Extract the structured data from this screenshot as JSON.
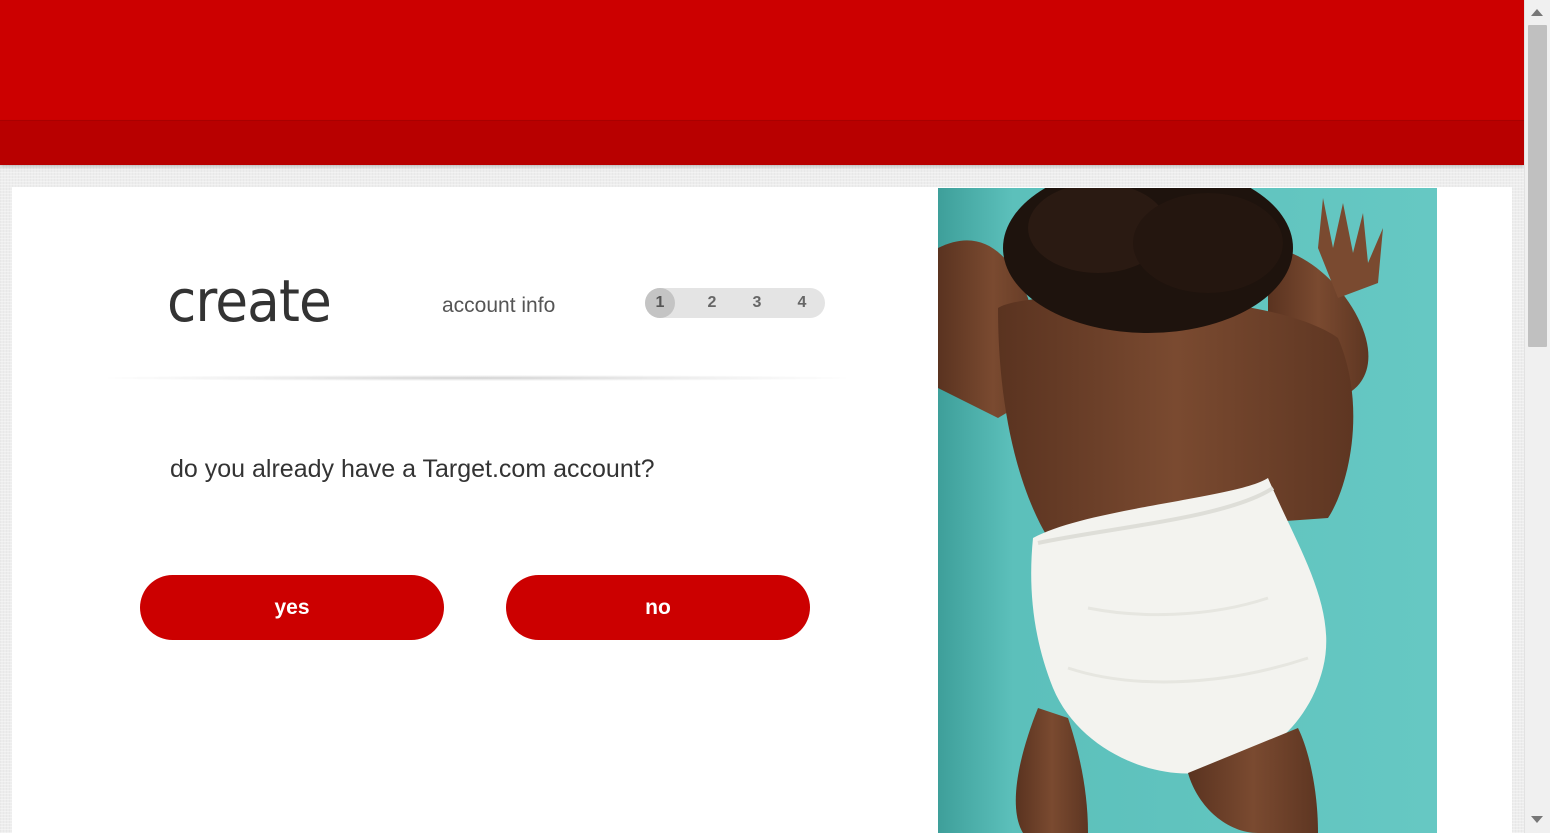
{
  "page": {
    "title": "create",
    "step_label": "account info",
    "steps": [
      "1",
      "2",
      "3",
      "4"
    ],
    "active_step": 1
  },
  "question": {
    "text": "do you already have a Target.com account?"
  },
  "buttons": {
    "yes_label": "yes",
    "no_label": "no"
  },
  "colors": {
    "brand_red": "#cc0000",
    "header_dark_red": "#b80000",
    "photo_background": "#5cc0bb"
  },
  "icons": {
    "scroll_up": "triangle-up",
    "scroll_down": "triangle-down"
  }
}
